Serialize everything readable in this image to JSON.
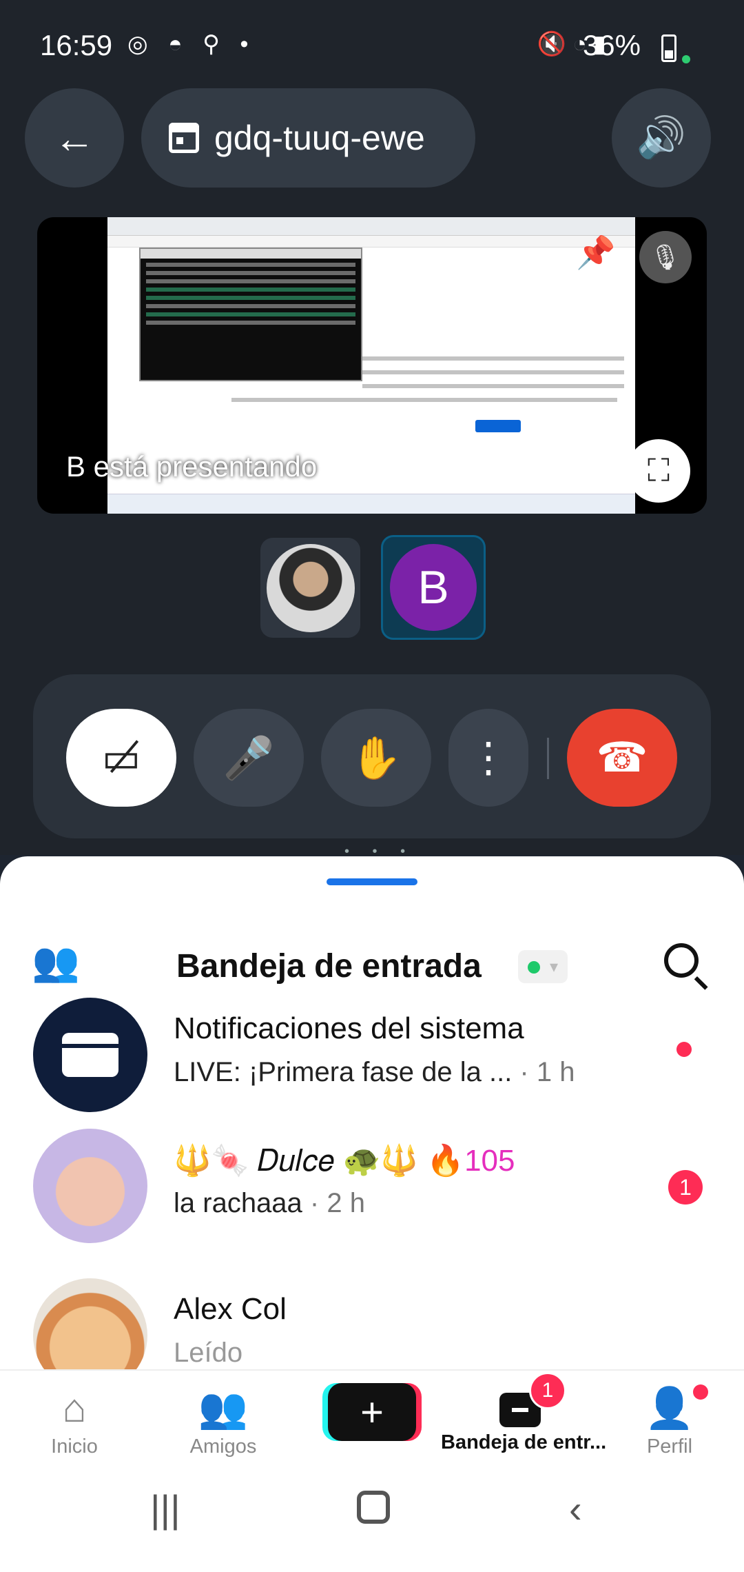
{
  "status_bar": {
    "time": "16:59",
    "left_icons": "◎ ◓ ⚲ •",
    "battery": "36%",
    "system_icons": "🔇 ◔ ▮"
  },
  "meet": {
    "room_code": "gdq-tuuq-ewe",
    "presenting_text": "B está presentando",
    "participant_b_initial": "B"
  },
  "inbox": {
    "title": "Bandeja de entrada",
    "items": [
      {
        "name": "Notificaciones del sistema",
        "preview": "LIVE: ¡Primera fase de la ...",
        "time": " · 1 h",
        "unread": "dot"
      },
      {
        "name": "🔱🍬 𝐷𝑢𝑙𝑐𝑒 🐢🔱",
        "streak": "🔥105",
        "preview": "la rachaaa",
        "time": " · 2 h",
        "unread_count": "1"
      },
      {
        "name": "Alex Col",
        "preview": "Leído"
      }
    ]
  },
  "bottom_nav": {
    "inicio": "Inicio",
    "amigos": "Amigos",
    "inbox": "Bandeja de entr...",
    "inbox_badge": "1",
    "perfil": "Perfil"
  },
  "colors": {
    "accent": "#1a73e8",
    "end_call": "#e8412f",
    "badge": "#fe2c55"
  }
}
